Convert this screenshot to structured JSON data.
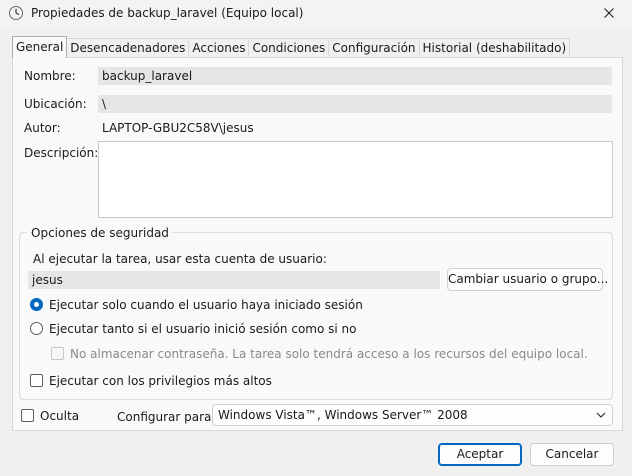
{
  "window": {
    "title": "Propiedades de backup_laravel (Equipo local)",
    "icon": "clock-icon"
  },
  "tabs": [
    {
      "label": "General",
      "active": true
    },
    {
      "label": "Desencadenadores",
      "active": false
    },
    {
      "label": "Acciones",
      "active": false
    },
    {
      "label": "Condiciones",
      "active": false
    },
    {
      "label": "Configuración",
      "active": false
    },
    {
      "label": "Historial (deshabilitado)",
      "active": false
    }
  ],
  "general": {
    "name_label": "Nombre:",
    "name_value": "backup_laravel",
    "location_label": "Ubicación:",
    "location_value": "\\",
    "author_label": "Autor:",
    "author_value": "LAPTOP-GBU2C58V\\jesus",
    "description_label": "Descripción:",
    "description_value": ""
  },
  "security": {
    "legend": "Opciones de seguridad",
    "run_as_label": "Al ejecutar la tarea, usar esta cuenta de usuario:",
    "user_value": "jesus",
    "change_user_button": "Cambiar usuario o grupo...",
    "radio_logged_on": {
      "label": "Ejecutar solo cuando el usuario haya iniciado sesión",
      "checked": true
    },
    "radio_whether": {
      "label": "Ejecutar tanto si el usuario inició sesión como si no",
      "checked": false
    },
    "no_store_password": {
      "label": "No almacenar contraseña. La tarea solo tendrá acceso a los recursos del equipo local.",
      "checked": false,
      "enabled": false
    },
    "highest_privileges": {
      "label": "Ejecutar con los privilegios más altos",
      "checked": false
    }
  },
  "bottom": {
    "hidden_label": "Oculta",
    "hidden_checked": false,
    "configure_label": "Configurar para:",
    "configure_value": "Windows Vista™, Windows Server™ 2008"
  },
  "buttons": {
    "accept": "Aceptar",
    "cancel": "Cancelar"
  },
  "colors": {
    "accent": "#0067c0"
  }
}
